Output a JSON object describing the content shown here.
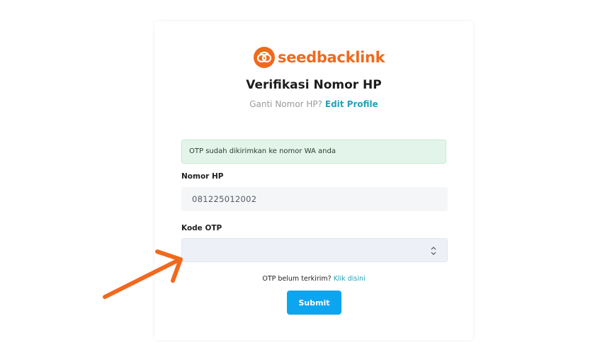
{
  "brand": {
    "name": "seedbacklink",
    "color": "#f06a1d",
    "icon": "chain-link-logo-icon"
  },
  "header": {
    "title": "Verifikasi Nomor HP",
    "subtitle_prefix": "Ganti Nomor HP?",
    "subtitle_link": "Edit Profile"
  },
  "alert": {
    "message": "OTP sudah dikirimkan ke nomor WA anda",
    "color": "#e3f5ea"
  },
  "form": {
    "phone": {
      "label": "Nomor HP",
      "value": "081225012002"
    },
    "otp": {
      "label": "Kode OTP",
      "value": "",
      "spinner_icon": "number-spinner-icon"
    },
    "resend_prefix": "OTP belum terkirim?",
    "resend_link": "Klik disini",
    "submit_label": "Submit"
  },
  "colors": {
    "accent_link": "#20a3b8",
    "submit_button": "#0ea5f0",
    "annotation_arrow": "#f06a1d"
  },
  "annotation": {
    "icon": "pointer-arrow-icon"
  }
}
